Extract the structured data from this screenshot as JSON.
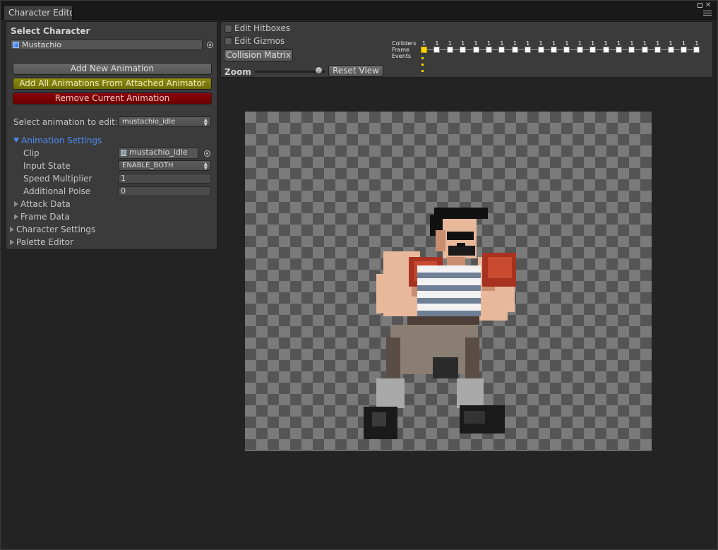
{
  "window": {
    "tab_title": "Character Editor"
  },
  "left_panel": {
    "heading": "Select Character",
    "character_value": "Mustachio",
    "buttons": {
      "add_new": "Add New Animation",
      "add_all": "Add All Animations From Attached Animator",
      "remove": "Remove Current Animation"
    },
    "select_anim_label": "Select animation to edit:",
    "select_anim_value": "mustachio_idle",
    "animation_settings": {
      "label": "Animation Settings",
      "clip_label": "Clip",
      "clip_value": "mustachio_idle",
      "input_state_label": "Input State",
      "input_state_value": "ENABLE_BOTH",
      "speed_label": "Speed Multiplier",
      "speed_value": "1",
      "poise_label": "Additional Poise",
      "poise_value": "0"
    },
    "foldouts": {
      "attack": "Attack Data",
      "frame": "Frame Data",
      "character": "Character Settings",
      "palette": "Palette Editor"
    }
  },
  "toolbar": {
    "edit_hitboxes": "Edit Hitboxes",
    "edit_gizmos": "Edit Gizmos",
    "collision_matrix": "Collision Matrix",
    "zoom_label": "Zoom",
    "zoom_level": 0.9,
    "reset_view": "Reset View"
  },
  "timeline": {
    "colliders_label": "Colliders",
    "frame_label": "Frame",
    "events_label": "Events",
    "collider_counts": [
      "1",
      "1",
      "1",
      "1",
      "1",
      "1",
      "1",
      "1",
      "1",
      "1",
      "1",
      "1",
      "1",
      "1",
      "1",
      "1",
      "1",
      "1",
      "1",
      "1",
      "1",
      "1"
    ],
    "frame_count": 22,
    "selected_frame": 0,
    "selected_color": "#ffd400"
  }
}
